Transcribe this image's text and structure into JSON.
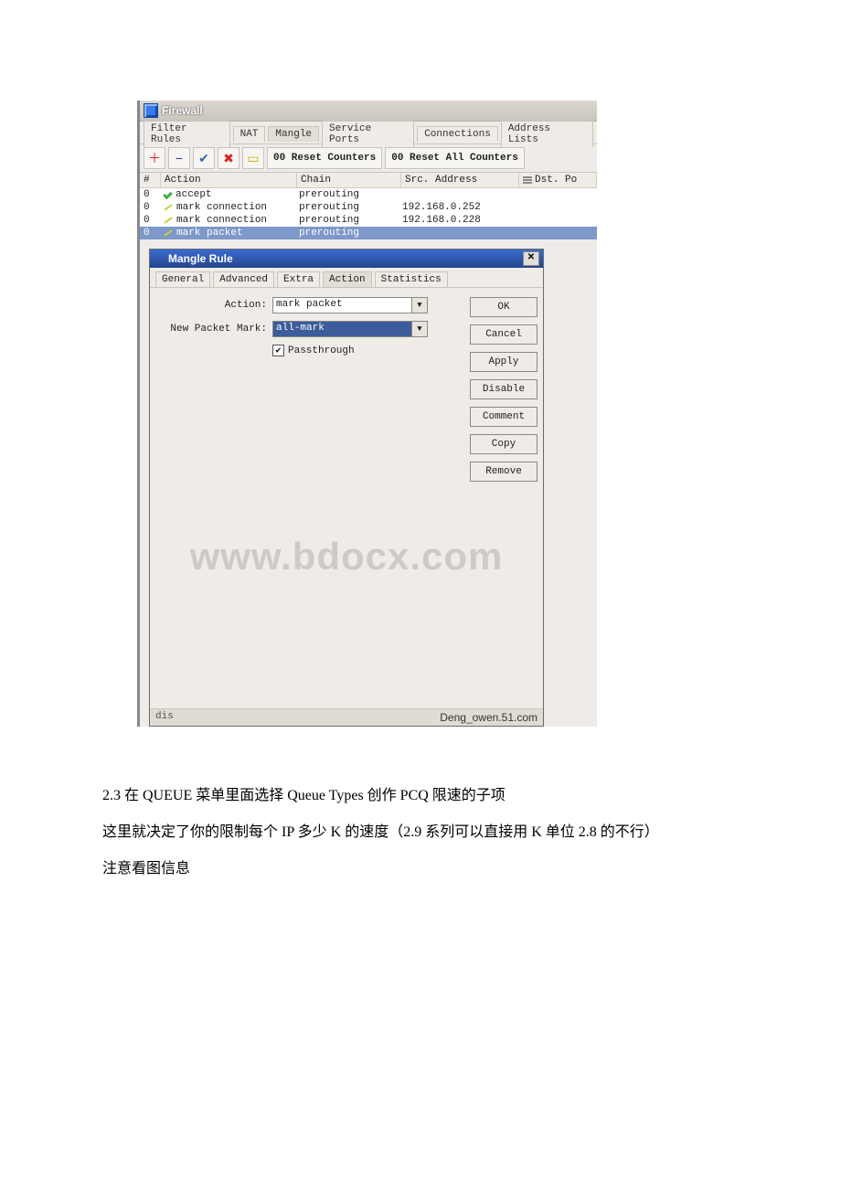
{
  "firewall": {
    "title": "Firewall",
    "tabs": [
      "Filter Rules",
      "NAT",
      "Mangle",
      "Service Ports",
      "Connections",
      "Address Lists"
    ],
    "active_tab": 2,
    "toolbar": {
      "reset_counters": "00 Reset Counters",
      "reset_all_counters": "00 Reset All Counters"
    },
    "columns": {
      "num": "#",
      "action": "Action",
      "chain": "Chain",
      "src_address": "Src. Address",
      "dst_po": "Dst. Po"
    },
    "rows": [
      {
        "num": "0",
        "action": "accept",
        "chain": "prerouting",
        "src": ""
      },
      {
        "num": "0",
        "action": "mark connection",
        "chain": "prerouting",
        "src": "192.168.0.252"
      },
      {
        "num": "0",
        "action": "mark connection",
        "chain": "prerouting",
        "src": "192.168.0.228"
      },
      {
        "num": "0",
        "action": "mark packet",
        "chain": "prerouting",
        "src": ""
      }
    ],
    "selected_row": 3
  },
  "mangle_rule": {
    "title": "Mangle Rule",
    "tabs": [
      "General",
      "Advanced",
      "Extra",
      "Action",
      "Statistics"
    ],
    "active_tab": 3,
    "labels": {
      "action": "Action:",
      "new_packet_mark": "New Packet Mark:",
      "passthrough": "Passthrough"
    },
    "values": {
      "action": "mark packet",
      "new_packet_mark": "all-mark",
      "passthrough_checked": true
    },
    "buttons": [
      "OK",
      "Cancel",
      "Apply",
      "Disable",
      "Comment",
      "Copy",
      "Remove"
    ]
  },
  "status": {
    "left": "dis",
    "right": "Deng_owen.51.com"
  },
  "watermark": "www.bdocx.com",
  "body_text": {
    "p1": "2.3 在 QUEUE 菜单里面选择 Queue Types 创作 PCQ 限速的子项",
    "p2": "这里就决定了你的限制每个 IP 多少 K 的速度（2.9 系列可以直接用 K 单位 2.8 的不行）",
    "p3": "注意看图信息"
  }
}
